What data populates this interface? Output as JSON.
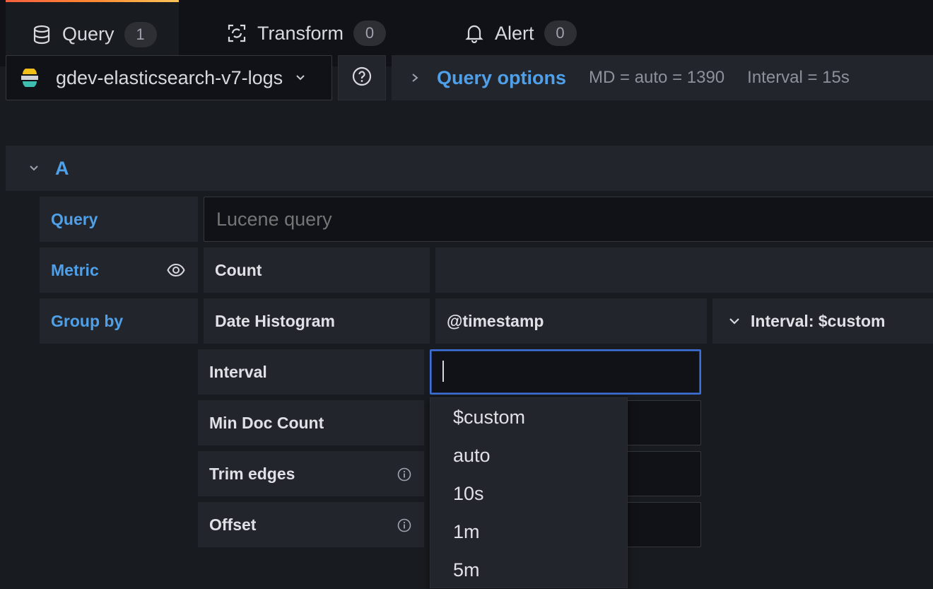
{
  "tabs": [
    {
      "label": "Query",
      "count": "1",
      "icon": "database-icon"
    },
    {
      "label": "Transform",
      "count": "0",
      "icon": "transform-icon"
    },
    {
      "label": "Alert",
      "count": "0",
      "icon": "bell-icon"
    }
  ],
  "datasource": {
    "name": "gdev-elasticsearch-v7-logs"
  },
  "query_options": {
    "label": "Query options",
    "md": "MD = auto = 1390",
    "interval": "Interval = 15s"
  },
  "query_row": {
    "ref_id": "A"
  },
  "editor": {
    "query_label": "Query",
    "query_placeholder": "Lucene query",
    "metric_label": "Metric",
    "metric_value": "Count",
    "group_by_label": "Group by",
    "group_by_type": "Date Histogram",
    "group_by_field": "@timestamp",
    "group_by_interval": "Interval: $custom",
    "settings": {
      "interval_label": "Interval",
      "interval_value": "",
      "min_doc_label": "Min Doc Count",
      "trim_edges_label": "Trim edges",
      "offset_label": "Offset"
    }
  },
  "interval_options": [
    "$custom",
    "auto",
    "10s",
    "1m",
    "5m"
  ],
  "colors": {
    "accent_blue": "#4fa0e8",
    "focus_border": "#3d71d9",
    "bg": "#181b1f",
    "panel": "#22252b"
  }
}
